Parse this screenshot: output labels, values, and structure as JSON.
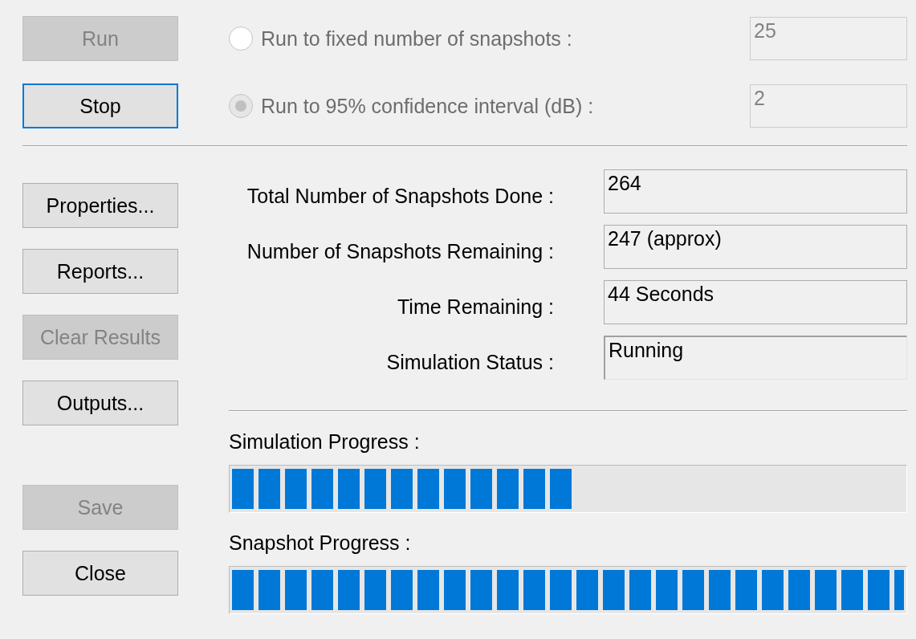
{
  "run_controls": [
    {
      "button": {
        "label": "Run",
        "disabled": true,
        "focused": false
      },
      "option": {
        "label": "Run to fixed number of snapshots :",
        "selected": false,
        "disabled": true
      },
      "field": {
        "value": "25",
        "disabled": true
      }
    },
    {
      "button": {
        "label": "Stop",
        "disabled": false,
        "focused": true
      },
      "option": {
        "label": "Run to 95% confidence interval (dB) :",
        "selected": true,
        "disabled": true
      },
      "field": {
        "value": "2",
        "disabled": true
      }
    }
  ],
  "side_buttons": [
    {
      "label": "Properties...",
      "disabled": false,
      "focused": false
    },
    {
      "label": "Reports...",
      "disabled": false,
      "focused": false
    },
    {
      "label": "Clear Results",
      "disabled": true,
      "focused": false
    },
    {
      "label": "Outputs...",
      "disabled": false,
      "focused": false
    }
  ],
  "bottom_buttons": [
    {
      "label": "Save",
      "disabled": true,
      "focused": false
    },
    {
      "label": "Close",
      "disabled": false,
      "focused": false
    }
  ],
  "stats": [
    {
      "label": "Total Number of Snapshots Done :",
      "value": "264",
      "kind": "readout"
    },
    {
      "label": "Number of Snapshots Remaining :",
      "value": "247 (approx)",
      "kind": "readout"
    },
    {
      "label": "Time Remaining :",
      "value": "44 Seconds",
      "kind": "readout"
    },
    {
      "label": "Simulation Status :",
      "value": "Running",
      "kind": "status"
    }
  ],
  "progress": [
    {
      "label": "Simulation Progress :",
      "level": 0.51
    },
    {
      "label": "Snapshot Progress :",
      "level": 1.0
    }
  ]
}
